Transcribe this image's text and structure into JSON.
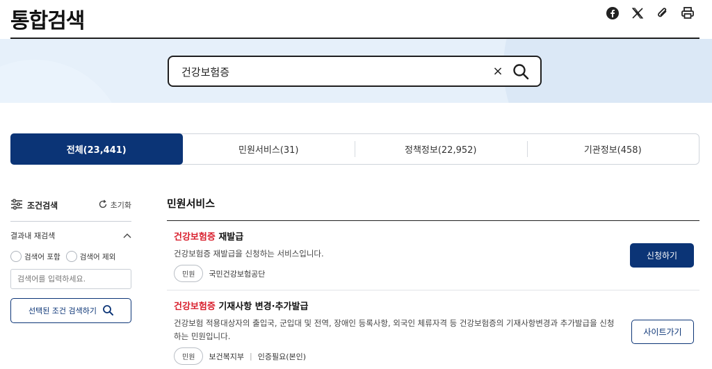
{
  "header": {
    "title": "통합검색",
    "icons": [
      "facebook-icon",
      "x-icon",
      "link-icon",
      "print-icon"
    ]
  },
  "search": {
    "value": "건강보험증",
    "clear_label": "×"
  },
  "tabs": [
    {
      "label": "전체(23,441)",
      "active": true
    },
    {
      "label": "민원서비스(31)",
      "active": false
    },
    {
      "label": "정책정보(22,952)",
      "active": false
    },
    {
      "label": "기관정보(458)",
      "active": false
    }
  ],
  "filter": {
    "title": "조건검색",
    "reset_label": "초기화",
    "subsection": "결과내 재검색",
    "radio_include": "검색어 포함",
    "radio_exclude": "검색어 제외",
    "input_placeholder": "검색어를 입력하세요.",
    "search_button": "선택된 조건 검색하기"
  },
  "results": {
    "section_title": "민원서비스",
    "items": [
      {
        "title_highlight": "건강보험증",
        "title_rest": " 재발급",
        "desc": "건강보험증 재발급을 신청하는 서비스입니다.",
        "chip": "민원",
        "org": "국민건강보험공단",
        "extra": "",
        "button": "신청하기"
      },
      {
        "title_highlight": "건강보험증",
        "title_rest": " 기재사항 변경·추가발급",
        "desc": "건강보험 적용대상자의 출입국, 군입대 및 전역, 장애인 등록사항, 외국인 체류자격 등 건강보험증의 기재사항변경과 추가발급을 신청하는 민원입니다.",
        "chip": "민원",
        "org": "보건복지부",
        "extra": "인증필요(본인)",
        "button": "사이트가기"
      }
    ]
  },
  "colors": {
    "primary": "#0b3476",
    "highlight": "#d81d2b",
    "band": "#e6f0fa"
  }
}
